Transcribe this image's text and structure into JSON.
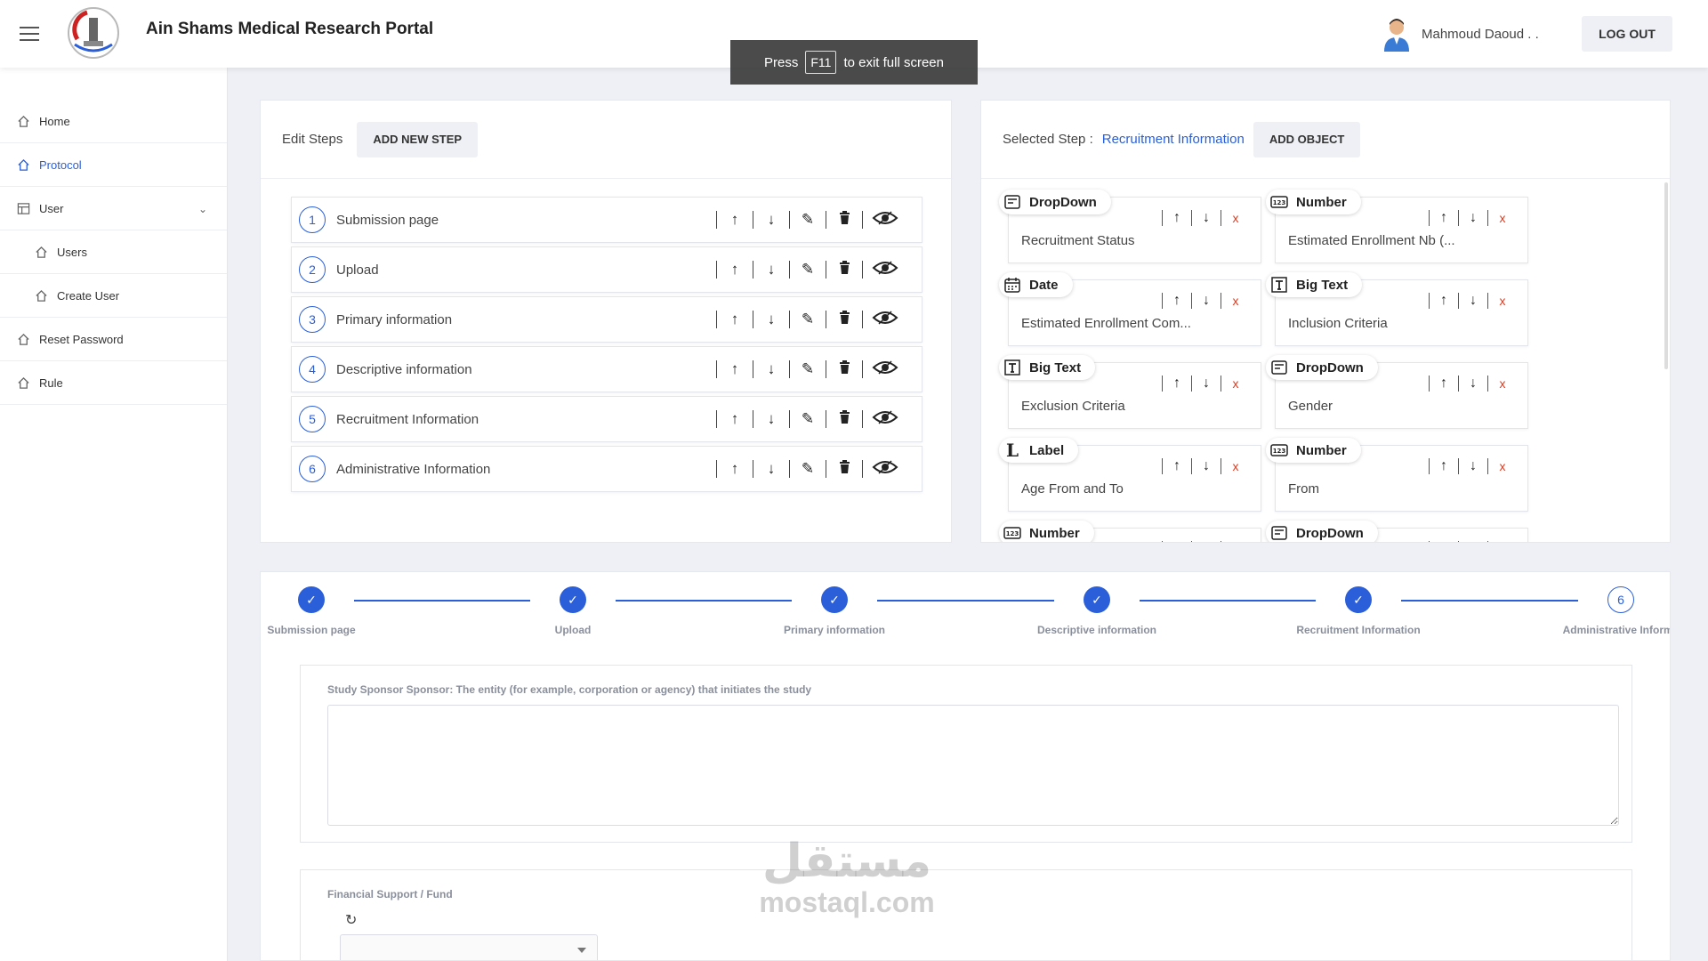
{
  "app": {
    "title": "Ain Shams Medical Research Portal"
  },
  "fullscreen_notice": {
    "press": "Press",
    "key": "F11",
    "suffix": "to exit full screen"
  },
  "user": {
    "name": "Mahmoud Daoud . .",
    "logout": "LOG OUT"
  },
  "sidebar": {
    "items": [
      {
        "label": "Home",
        "icon": "home-icon"
      },
      {
        "label": "Protocol",
        "icon": "home-icon",
        "active": true
      },
      {
        "label": "User",
        "icon": "table-icon"
      },
      {
        "label": "Users",
        "icon": "home-icon"
      },
      {
        "label": "Create User",
        "icon": "home-icon"
      },
      {
        "label": "Reset Password",
        "icon": "home-icon"
      },
      {
        "label": "Rule",
        "icon": "home-icon"
      }
    ]
  },
  "edit_steps": {
    "title": "Edit Steps",
    "add_button": "ADD NEW STEP",
    "steps": [
      {
        "num": "1",
        "label": "Submission page"
      },
      {
        "num": "2",
        "label": "Upload"
      },
      {
        "num": "3",
        "label": "Primary information"
      },
      {
        "num": "4",
        "label": "Descriptive information"
      },
      {
        "num": "5",
        "label": "Recruitment Information"
      },
      {
        "num": "6",
        "label": "Administrative Information"
      }
    ]
  },
  "selected_step": {
    "prefix": "Selected Step :",
    "name": "Recruitment Information",
    "add_button": "ADD OBJECT",
    "objects": [
      {
        "type": "DropDown",
        "label": "Recruitment Status",
        "icon": "dropdown-icon"
      },
      {
        "type": "Number",
        "label": "Estimated Enrollment Nb (...",
        "icon": "number-icon"
      },
      {
        "type": "Date",
        "label": "Estimated Enrollment Com...",
        "icon": "calendar-icon"
      },
      {
        "type": "Big Text",
        "label": "Inclusion Criteria",
        "icon": "big-text-icon"
      },
      {
        "type": "Big Text",
        "label": "Exclusion Criteria",
        "icon": "big-text-icon"
      },
      {
        "type": "DropDown",
        "label": "Gender",
        "icon": "dropdown-icon"
      },
      {
        "type": "Label",
        "label": "Age From and To",
        "icon": "label-icon"
      },
      {
        "type": "Number",
        "label": "From",
        "icon": "number-icon"
      },
      {
        "type": "Number",
        "label": "",
        "icon": "number-icon"
      },
      {
        "type": "DropDown",
        "label": "",
        "icon": "dropdown-icon"
      }
    ]
  },
  "wizard": {
    "steps": [
      {
        "label": "Submission page",
        "state": "done",
        "num": "1"
      },
      {
        "label": "Upload",
        "state": "done",
        "num": "2"
      },
      {
        "label": "Primary information",
        "state": "done",
        "num": "3"
      },
      {
        "label": "Descriptive information",
        "state": "done",
        "num": "4"
      },
      {
        "label": "Recruitment Information",
        "state": "done",
        "num": "5"
      },
      {
        "label": "Administrative Informa",
        "state": "current",
        "num": "6"
      }
    ]
  },
  "form": {
    "sponsor_label": "Study Sponsor Sponsor: The entity (for example, corporation or agency) that initiates the study",
    "sponsor_value": "",
    "fund_label": "Financial Support / Fund"
  },
  "watermark": {
    "arabic": "مستقل",
    "latin": "mostaql.com"
  },
  "colors": {
    "accent": "#2b5fd9",
    "danger": "#e03a1e"
  }
}
